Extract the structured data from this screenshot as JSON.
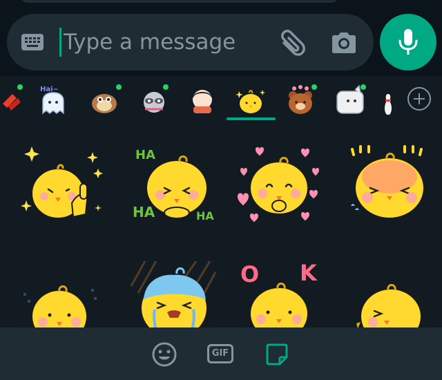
{
  "composer": {
    "placeholder": "Type a message"
  },
  "stickers_tray": {
    "selected_index": 5
  },
  "grid": {
    "row1": [
      {
        "name": "sparkle-chick"
      },
      {
        "name": "laughing-chick",
        "text": [
          "HA",
          "HA",
          "HA"
        ]
      },
      {
        "name": "love-chick"
      },
      {
        "name": "blushing-chick"
      }
    ],
    "row2": [
      {
        "name": "praying-chick"
      },
      {
        "name": "crying-chick"
      },
      {
        "name": "ok-chick",
        "text": [
          "O",
          "K"
        ]
      },
      {
        "name": "hello-chick"
      }
    ]
  },
  "tabs": {
    "emoji": "emoji",
    "gif": "GIF",
    "sticker": "sticker"
  }
}
